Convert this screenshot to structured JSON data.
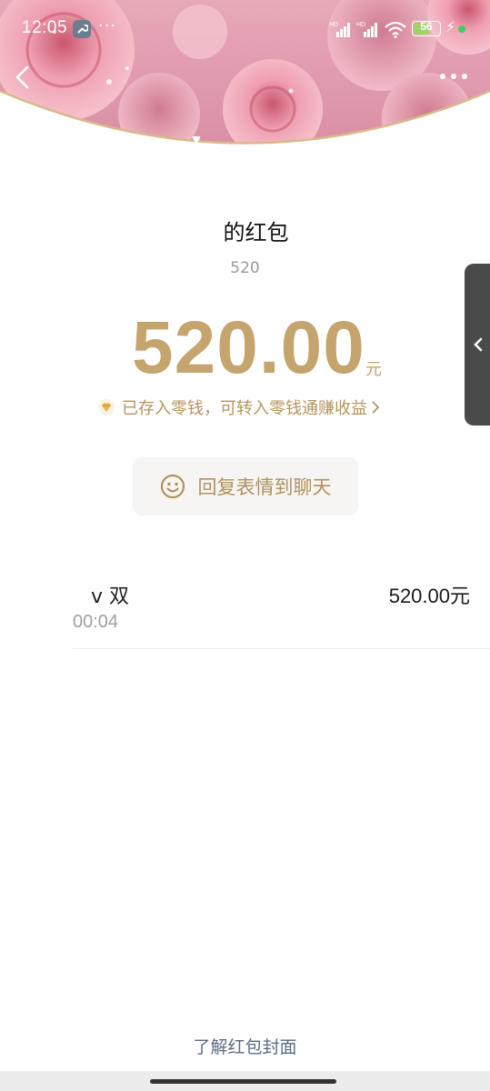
{
  "status_bar": {
    "time": "12:05",
    "app_dots": "···",
    "network_1": "HD",
    "network_2": "HD",
    "battery_level": "56",
    "accent_green": "#3ecf5a"
  },
  "cover": {
    "theme": "pink-roses",
    "border_color": "#d9b98a"
  },
  "header": {
    "sender_title": "的红包",
    "greeting": "520"
  },
  "amount": {
    "value": "520.00",
    "unit": "元",
    "color": "#c5a46e"
  },
  "saved_notice": {
    "text": "已存入零钱，可转入零钱通赚收益",
    "icon": "gem-icon"
  },
  "reply_button": {
    "label": "回复表情到聊天",
    "icon": "smile-icon"
  },
  "receiver": {
    "name": "v 双",
    "time": "00:04",
    "amount": "520.00元"
  },
  "side_tab": {
    "icon": "chevron-left-icon"
  },
  "footer": {
    "cover_link": "了解红包封面"
  }
}
